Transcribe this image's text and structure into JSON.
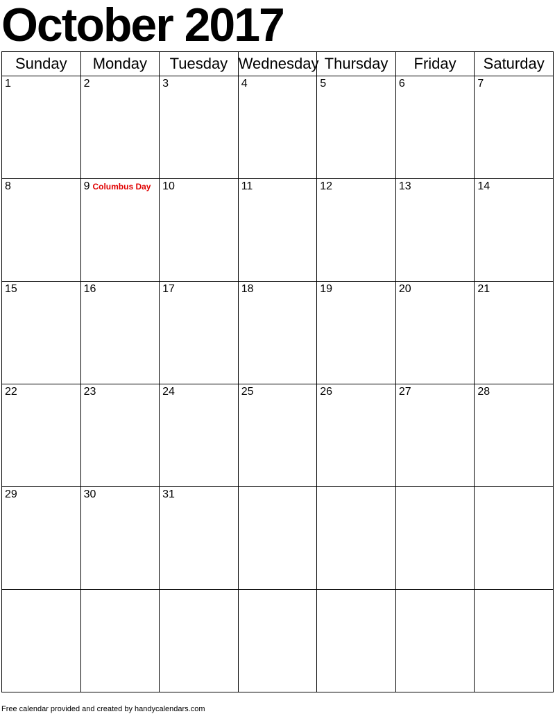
{
  "title": "October 2017",
  "weekdays": [
    "Sunday",
    "Monday",
    "Tuesday",
    "Wednesday",
    "Thursday",
    "Friday",
    "Saturday"
  ],
  "weeks": [
    [
      {
        "day": "1"
      },
      {
        "day": "2"
      },
      {
        "day": "3"
      },
      {
        "day": "4"
      },
      {
        "day": "5"
      },
      {
        "day": "6"
      },
      {
        "day": "7"
      }
    ],
    [
      {
        "day": "8"
      },
      {
        "day": "9",
        "holiday": "Columbus Day"
      },
      {
        "day": "10"
      },
      {
        "day": "11"
      },
      {
        "day": "12"
      },
      {
        "day": "13"
      },
      {
        "day": "14"
      }
    ],
    [
      {
        "day": "15"
      },
      {
        "day": "16"
      },
      {
        "day": "17"
      },
      {
        "day": "18"
      },
      {
        "day": "19"
      },
      {
        "day": "20"
      },
      {
        "day": "21"
      }
    ],
    [
      {
        "day": "22"
      },
      {
        "day": "23"
      },
      {
        "day": "24"
      },
      {
        "day": "25"
      },
      {
        "day": "26"
      },
      {
        "day": "27"
      },
      {
        "day": "28"
      }
    ],
    [
      {
        "day": "29"
      },
      {
        "day": "30"
      },
      {
        "day": "31"
      },
      {
        "day": ""
      },
      {
        "day": ""
      },
      {
        "day": ""
      },
      {
        "day": ""
      }
    ],
    [
      {
        "day": ""
      },
      {
        "day": ""
      },
      {
        "day": ""
      },
      {
        "day": ""
      },
      {
        "day": ""
      },
      {
        "day": ""
      },
      {
        "day": ""
      }
    ]
  ],
  "footer": "Free calendar provided and created by handycalendars.com"
}
